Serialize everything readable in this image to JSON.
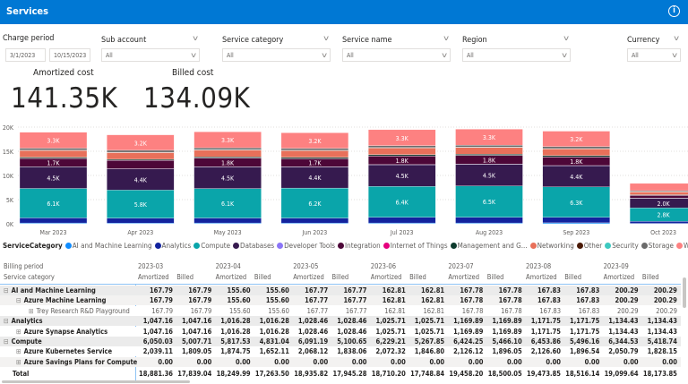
{
  "header": {
    "title": "Services",
    "info_icon": "info-icon"
  },
  "filters": {
    "charge_period": {
      "label": "Charge period",
      "start": "3/1/2023",
      "end": "10/15/2023"
    },
    "sub_account": {
      "label": "Sub account",
      "value": "All"
    },
    "service_category": {
      "label": "Service category",
      "value": "All"
    },
    "service_name": {
      "label": "Service name",
      "value": "All"
    },
    "region": {
      "label": "Region",
      "value": "All"
    },
    "currency": {
      "label": "Currency",
      "value": "All"
    }
  },
  "kpis": {
    "amortized_label": "Amortized cost",
    "amortized_value": "141.35K",
    "billed_label": "Billed cost",
    "billed_value": "134.09K"
  },
  "chart_data": {
    "type": "bar",
    "stacked": true,
    "ylim": [
      0,
      20000
    ],
    "grid": true,
    "yticks": [
      "0K",
      "5K",
      "10K",
      "15K",
      "20K"
    ],
    "categories": [
      "Mar 2023",
      "Apr 2023",
      "May 2023",
      "Jun 2023",
      "Jul 2023",
      "Aug 2023",
      "Sep 2023",
      "Oct 2023"
    ],
    "legend_title": "ServiceCategory",
    "legend_position": "bottom",
    "series": [
      {
        "name": "AI and Machine Learning",
        "color": "#118DFF",
        "values": [
          168,
          156,
          168,
          163,
          168,
          168,
          200,
          80
        ]
      },
      {
        "name": "Analytics",
        "color": "#12239E",
        "values": [
          1047,
          1016,
          1028,
          1026,
          1170,
          1172,
          1134,
          420
        ]
      },
      {
        "name": "Compute",
        "color": "#0AA5AA",
        "values": [
          6100,
          5800,
          6100,
          6200,
          6400,
          6500,
          6300,
          2800
        ],
        "labels": [
          "6.1K",
          "5.8K",
          "6.1K",
          "6.2K",
          "6.4K",
          "6.5K",
          "6.3K",
          "2.8K"
        ]
      },
      {
        "name": "Databases",
        "color": "#361A4F",
        "values": [
          4500,
          4400,
          4500,
          4400,
          4500,
          4500,
          4400,
          2000
        ],
        "labels": [
          "4.5K",
          "4.4K",
          "4.5K",
          "4.4K",
          "4.5K",
          "4.5K",
          "4.4K",
          "2.0K"
        ]
      },
      {
        "name": "Developer Tools",
        "color": "#8B75F7",
        "values": [
          10,
          10,
          10,
          10,
          10,
          10,
          10,
          5
        ]
      },
      {
        "name": "Integration",
        "color": "#4D0738",
        "values": [
          1700,
          1750,
          1800,
          1700,
          1800,
          1800,
          1800,
          600
        ],
        "labels": [
          "1.7K",
          "",
          "1.8K",
          "1.7K",
          "1.8K",
          "1.8K",
          "1.8K",
          ""
        ]
      },
      {
        "name": "Internet of Things",
        "color": "#E6007E",
        "values": [
          10,
          10,
          10,
          10,
          10,
          10,
          10,
          5
        ]
      },
      {
        "name": "Management and G...",
        "color": "#0D3B2E",
        "values": [
          250,
          200,
          250,
          250,
          250,
          250,
          250,
          100
        ]
      },
      {
        "name": "Networking",
        "color": "#E8705A",
        "values": [
          1400,
          1400,
          1400,
          1400,
          1400,
          1400,
          1400,
          600
        ]
      },
      {
        "name": "Other",
        "color": "#4A1A06",
        "values": [
          30,
          30,
          30,
          30,
          30,
          30,
          30,
          20
        ]
      },
      {
        "name": "Security",
        "color": "#3DC9C0",
        "values": [
          30,
          30,
          30,
          30,
          30,
          30,
          30,
          20
        ]
      },
      {
        "name": "Storage",
        "color": "#6B6B6B",
        "values": [
          400,
          400,
          400,
          400,
          400,
          400,
          400,
          200
        ]
      },
      {
        "name": "Web",
        "color": "#FD8181",
        "values": [
          3300,
          3200,
          3300,
          3200,
          3300,
          3300,
          3200,
          1500
        ],
        "labels": [
          "3.3K",
          "3.2K",
          "3.3K",
          "3.2K",
          "3.3K",
          "3.3K",
          "3.2K",
          ""
        ]
      }
    ]
  },
  "matrix": {
    "row_header_1": "Billing period",
    "row_header_2": "Service category",
    "periods": [
      "2023-03",
      "2023-04",
      "2023-05",
      "2023-06",
      "2023-07",
      "2023-08",
      "2023-09"
    ],
    "sub_headers": [
      "Amortized",
      "Billed"
    ],
    "rows": [
      {
        "label": "AI and Machine Learning",
        "level": 0,
        "toggle": "⊟",
        "values": [
          "167.79",
          "167.79",
          "155.60",
          "155.60",
          "167.77",
          "167.77",
          "162.81",
          "162.81",
          "167.78",
          "167.78",
          "167.83",
          "167.83",
          "200.29",
          "200.29"
        ]
      },
      {
        "label": "Azure Machine Learning",
        "level": 1,
        "toggle": "⊟",
        "values": [
          "167.79",
          "167.79",
          "155.60",
          "155.60",
          "167.77",
          "167.77",
          "162.81",
          "162.81",
          "167.78",
          "167.78",
          "167.83",
          "167.83",
          "200.29",
          "200.29"
        ]
      },
      {
        "label": "Trey Research R&D Playground",
        "level": 2,
        "toggle": "⊞",
        "values": [
          "167.79",
          "167.79",
          "155.60",
          "155.60",
          "167.77",
          "167.77",
          "162.81",
          "162.81",
          "167.78",
          "167.78",
          "167.83",
          "167.83",
          "200.29",
          "200.29"
        ]
      },
      {
        "label": "Analytics",
        "level": 0,
        "toggle": "⊟",
        "values": [
          "1,047.16",
          "1,047.16",
          "1,016.28",
          "1,016.28",
          "1,028.46",
          "1,028.46",
          "1,025.71",
          "1,025.71",
          "1,169.89",
          "1,169.89",
          "1,171.75",
          "1,171.75",
          "1,134.43",
          "1,134.43"
        ]
      },
      {
        "label": "Azure Synapse Analytics",
        "level": 1,
        "toggle": "⊞",
        "values": [
          "1,047.16",
          "1,047.16",
          "1,016.28",
          "1,016.28",
          "1,028.46",
          "1,028.46",
          "1,025.71",
          "1,025.71",
          "1,169.89",
          "1,169.89",
          "1,171.75",
          "1,171.75",
          "1,134.43",
          "1,134.43"
        ]
      },
      {
        "label": "Compute",
        "level": 0,
        "toggle": "⊟",
        "values": [
          "6,050.03",
          "5,007.71",
          "5,817.53",
          "4,831.04",
          "6,091.19",
          "5,100.65",
          "6,229.21",
          "5,267.85",
          "6,424.25",
          "5,466.10",
          "6,453.86",
          "5,496.16",
          "6,344.53",
          "5,418.74"
        ]
      },
      {
        "label": "Azure Kubernetes Service",
        "level": 1,
        "toggle": "⊞",
        "values": [
          "2,039.11",
          "1,809.05",
          "1,874.75",
          "1,652.11",
          "2,068.12",
          "1,838.06",
          "2,072.32",
          "1,846.80",
          "2,126.12",
          "1,896.05",
          "2,126.60",
          "1,896.54",
          "2,050.79",
          "1,828.15"
        ]
      },
      {
        "label": "Azure Savings Plans for Compute",
        "level": 1,
        "toggle": "⊞",
        "values": [
          "0.00",
          "0.00",
          "0.00",
          "0.00",
          "0.00",
          "0.00",
          "0.00",
          "0.00",
          "0.00",
          "0.00",
          "0.00",
          "0.00",
          "0.00",
          "0.00"
        ]
      }
    ],
    "total": {
      "label": "Total",
      "values": [
        "18,881.36",
        "17,839.04",
        "18,249.99",
        "17,263.50",
        "18,935.82",
        "17,945.28",
        "18,710.20",
        "17,748.84",
        "19,458.20",
        "18,500.05",
        "19,473.85",
        "18,516.14",
        "19,099.64",
        "18,173.85"
      ]
    }
  }
}
